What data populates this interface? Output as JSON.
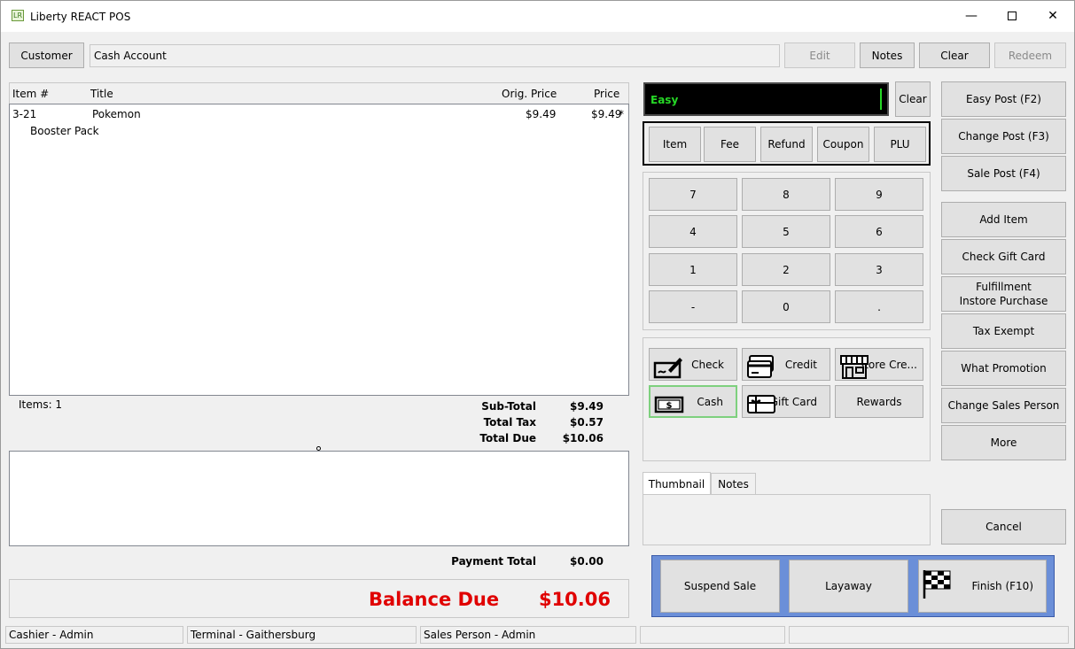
{
  "window": {
    "title": "Liberty REACT POS",
    "icon_text": "LR"
  },
  "toolbar": {
    "customer_label": "Customer",
    "account_value": "Cash Account",
    "edit_label": "Edit",
    "notes_label": "Notes",
    "clear_label": "Clear",
    "redeem_label": "Redeem"
  },
  "grid": {
    "columns": [
      "Item #",
      "Title",
      "Orig. Price",
      "Price"
    ],
    "rows": [
      {
        "item": "3-21",
        "title": "Pokemon",
        "subtitle": "Booster Pack",
        "orig_price": "$9.49",
        "price": "$9.49",
        "flag": "*"
      }
    ]
  },
  "summary": {
    "items_label": "Items: 1",
    "subtotal_label": "Sub-Total",
    "subtotal": "$9.49",
    "tax_label": "Total Tax",
    "tax": "$0.57",
    "due_label": "Total Due",
    "due": "$10.06",
    "payment_total_label": "Payment Total",
    "payment_total": "$0.00",
    "balance_label": "Balance Due",
    "balance": "$10.06"
  },
  "entry": {
    "mode_text": "Easy",
    "clear_label": "Clear"
  },
  "entry_types": [
    "Item",
    "Fee",
    "Refund",
    "Coupon",
    "PLU"
  ],
  "keypad": [
    "7",
    "8",
    "9",
    "4",
    "5",
    "6",
    "1",
    "2",
    "3",
    "-",
    "0",
    "."
  ],
  "payments": {
    "check": "Check",
    "credit": "Credit",
    "store_credit": "Store Cre...",
    "cash": "Cash",
    "gift_card": "Gift Card",
    "rewards": "Rewards"
  },
  "tabs": {
    "thumbnail": "Thumbnail",
    "notes": "Notes"
  },
  "actions": {
    "suspend": "Suspend Sale",
    "layaway": "Layaway",
    "finish": "Finish (F10)"
  },
  "side": {
    "easy_post": "Easy Post (F2)",
    "change_post": "Change Post (F3)",
    "sale_post": "Sale Post (F4)",
    "add_item": "Add Item",
    "check_gift_card": "Check Gift Card",
    "fulfillment_1": "Fulfillment",
    "fulfillment_2": "Instore Purchase",
    "tax_exempt": "Tax Exempt",
    "what_promotion": "What Promotion",
    "change_sales_person": "Change Sales Person",
    "more": "More",
    "cancel": "Cancel"
  },
  "statusbar": {
    "cashier": "Cashier - Admin",
    "terminal": "Terminal - Gaithersburg",
    "sales_person": "Sales Person - Admin"
  },
  "colors": {
    "balance": "#e00000",
    "entry_text": "#26d826",
    "action_frame": "#6b8fd8"
  }
}
